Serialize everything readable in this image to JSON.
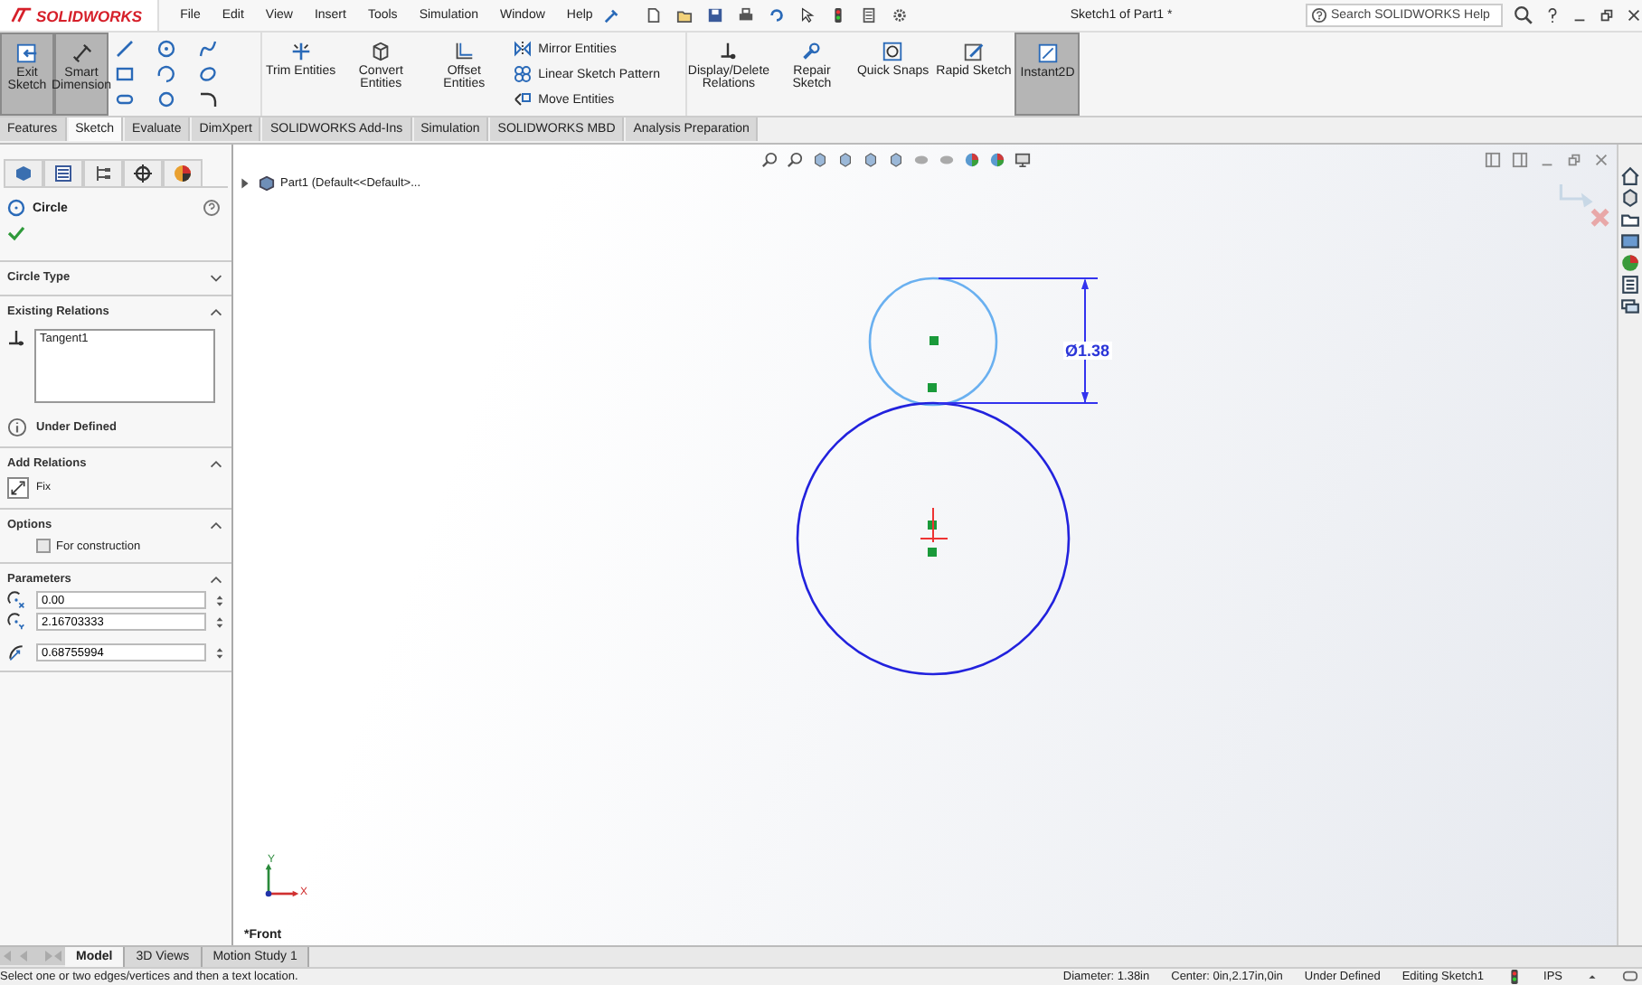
{
  "app": {
    "logo": "SOLIDWORKS",
    "menu": [
      "File",
      "Edit",
      "View",
      "Insert",
      "Tools",
      "Simulation",
      "Window",
      "Help"
    ],
    "document_title": "Sketch1 of Part1 *",
    "search": {
      "placeholder": "Search SOLIDWORKS Help"
    }
  },
  "ribbon": {
    "large_buttons": [
      {
        "label": "Exit Sketch",
        "kind": "exit",
        "active": true
      },
      {
        "label": "Smart Dimension",
        "kind": "dimension",
        "active": true
      }
    ],
    "tool_buttons": [
      {
        "label": "Trim Entities",
        "kind": "trim"
      },
      {
        "label": "Convert Entities",
        "kind": "convert"
      },
      {
        "label": "Offset Entities",
        "kind": "offset"
      }
    ],
    "small_buttons": [
      {
        "label": "Mirror Entities",
        "kind": "mirror"
      },
      {
        "label": "Linear Sketch Pattern",
        "kind": "pattern"
      },
      {
        "label": "Move Entities",
        "kind": "move"
      }
    ],
    "end_buttons": [
      {
        "label": "Display/Delete Relations",
        "kind": "relations",
        "active": false
      },
      {
        "label": "Repair Sketch",
        "kind": "repair",
        "active": false
      },
      {
        "label": "Quick Snaps",
        "kind": "snaps",
        "active": false
      },
      {
        "label": "Rapid Sketch",
        "kind": "rapid",
        "active": false
      },
      {
        "label": "Instant2D",
        "kind": "instant",
        "active": true
      }
    ]
  },
  "tabs": [
    {
      "label": "Features",
      "selected": false
    },
    {
      "label": "Sketch",
      "selected": true
    },
    {
      "label": "Evaluate",
      "selected": false
    },
    {
      "label": "DimXpert",
      "selected": false
    },
    {
      "label": "SOLIDWORKS Add-Ins",
      "selected": false
    },
    {
      "label": "Simulation",
      "selected": false
    },
    {
      "label": "SOLIDWORKS MBD",
      "selected": false
    },
    {
      "label": "Analysis Preparation",
      "selected": false
    }
  ],
  "property_manager": {
    "title": "Circle",
    "sections": [
      {
        "title": "Circle Type",
        "expanded": false
      },
      {
        "kind": "relations",
        "title": "Existing Relations",
        "expanded": true,
        "items": [
          "Tangent1"
        ],
        "status": "Under Defined"
      },
      {
        "kind": "add",
        "title": "Add Relations",
        "expanded": true,
        "items": [
          "Fix"
        ]
      },
      {
        "kind": "options",
        "title": "Options",
        "expanded": true,
        "checkbox": {
          "label": "For construction",
          "checked": false
        }
      },
      {
        "kind": "parameters",
        "title": "Parameters",
        "expanded": true,
        "values": [
          "0.00",
          "2.16703333",
          "0.68755994"
        ]
      }
    ]
  },
  "tree": {
    "label": "Part1  (Default<<Default>..."
  },
  "canvas": {
    "dimension": "Ø1.38",
    "view_label": "*Front",
    "axis_labels": [
      "Y",
      "X"
    ]
  },
  "bottom_tabs": [
    {
      "label": "Model",
      "selected": true
    },
    {
      "label": "3D Views",
      "selected": false
    },
    {
      "label": "Motion Study 1",
      "selected": false
    }
  ],
  "status_bar": {
    "message": "Select one or two edges/vertices and then a text location.",
    "items": [
      "Diameter: 1.38in",
      "Center: 0in,2.17in,0in",
      "Under Defined",
      "Editing Sketch1",
      "IPS"
    ]
  }
}
